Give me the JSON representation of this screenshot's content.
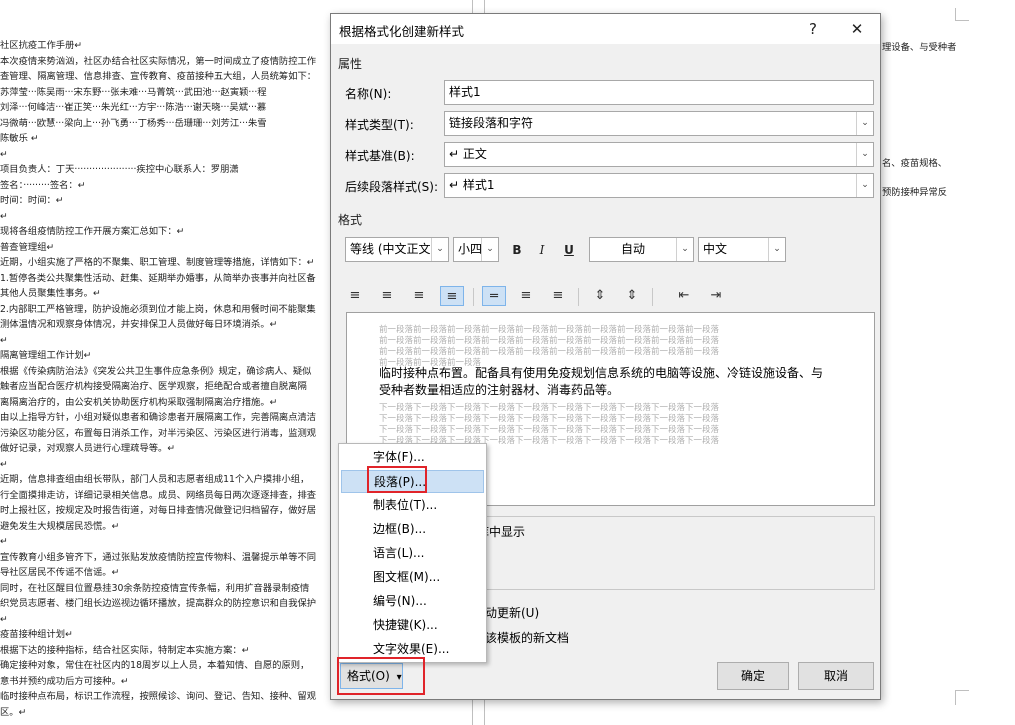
{
  "document": {
    "lines": [
      "社区抗疫工作手册↵",
      "本次疫情来势汹汹，社区办结合社区实际情况，第一时间成立了疫情防控工作",
      "查管理、隔离管理、信息排查、宣传教育、疫苗接种五大组，人员统筹如下：",
      "苏萍莹···陈吴雨···宋东野···张未难···马菁筑···武田池···赵寅颖···程",
      "刘泽···何峰洁···崔正笑···朱光红···方宇···陈浩···谢天晓···吴斌···慕",
      "冯微萌···欧慧···梁向上···孙飞勇···丁杨秀···岳珊珊···刘芳江···朱雪",
      "陈敏乐 ↵",
      "↵",
      "项目负责人：丁天·····················疾控中心联系人：罗朋潇",
      "签名：·········签名：↵",
      "时间：时间：↵",
      "↵",
      "现将各组疫情防控工作开展方案汇总如下：↵",
      "普查管理组↵",
      "近期，小组实施了严格的不聚集、职工管理、制度管理等措施，详情如下：↵",
      "1.暂停各类公共聚集性活动、赶集、延期举办婚事，从简举办丧事并向社区备",
      "其他人员聚集性事务。↵",
      "2.内部职工严格管理，防护设施必须到位才能上岗，休息和用餐时间不能聚集",
      "测体温情况和观察身体情况，并安排保卫人员做好每日环境消杀。↵",
      "↵",
      "隔离管理组工作计划↵",
      "根据《传染病防治法》《突发公共卫生事件应急条例》规定，确诊病人、疑似",
      "触者应当配合医疗机构接受隔离治疗、医学观察，拒绝配合或者擅自脱离隔",
      "离隔离治疗的，由公安机关协助医疗机构采取强制隔离治疗措施。↵",
      "由以上指导方针，小组对疑似患者和确诊患者开展隔离工作，完善隔离点清洁",
      "污染区功能分区，布置每日消杀工作，对半污染区、污染区进行消毒，监测观",
      "做好记录，对观察人员进行心理疏导等。↵",
      "↵",
      "近期，信息排查组由组长带队，部门人员和志愿者组成11个入户摸排小组，",
      "行全面摸排走访，详细记录相关信息。成员、网络员每日两次逐逐排查，排查",
      "时上报社区，按规定及时报告街道，对每日排查情况做登记归档留存，做好居",
      "避免发生大规模居民恐慌。↵",
      "↵",
      "宣传教育小组多管齐下，通过张贴发放疫情防控宣传物料、温馨提示单等不同",
      "导社区居民不传谣不信谣。↵",
      "同时，在社区醒目位置悬挂30余条防控疫情宣传条幅，利用扩音器录制疫情",
      "织党员志愿者、楼门组长边巡视边循环播放，提高群众的防控意识和自我保护",
      "↵",
      "疫苗接种组计划↵",
      "根据下达的接种指标，结合社区实际，特制定本实施方案：↵",
      "确定接种对象，常住在社区内的18周岁以上人员，本着知情、自愿的原则，",
      "意书并预约成功后方可接种。↵",
      "临时接种点布局，标识工作流程，按照候诊、询问、登记、告知、接种、留观",
      "区。↵"
    ],
    "right_lines": [
      "理设备、与受种者",
      "名、疫苗规格、",
      "预防接种异常反"
    ]
  },
  "dialog": {
    "title": "根据格式化创建新样式",
    "help": "?",
    "close": "✕",
    "section_properties": "属性",
    "name_label": "名称(N):",
    "name_value": "样式1",
    "type_label": "样式类型(T):",
    "type_value": "链接段落和字符",
    "base_label": "样式基准(B):",
    "base_value": "↵ 正文",
    "next_label": "后续段落样式(S):",
    "next_value": "↵ 样式1",
    "section_format": "格式",
    "font_value": "等线 (中文正文)",
    "size_value": "小四",
    "bold": "B",
    "italic": "I",
    "underline": "U",
    "color_value": "自动",
    "lang_value": "中文",
    "preview": {
      "prev_lines": [
        "前一段落前一段落前一段落前一段落前一段落前一段落前一段落前一段落前一段落前一段落",
        "前一段落前一段落前一段落前一段落前一段落前一段落前一段落前一段落前一段落前一段落",
        "前一段落前一段落前一段落前一段落前一段落前一段落前一段落前一段落前一段落前一段落",
        "前一段落前一段落前一段落"
      ],
      "main_lines": [
        "临时接种点布置。配备具有使用免疫规划信息系统的电脑等设施、冷链设施设备、与",
        "受种者数量相适应的注射器材、消毒药品等。"
      ],
      "next_lines": [
        "下一段落下一段落下一段落下一段落下一段落下一段落下一段落下一段落下一段落下一段落",
        "下一段落下一段落下一段落下一段落下一段落下一段落下一段落下一段落下一段落下一段落",
        "下一段落下一段落下一段落下一段落下一段落下一段落下一段落下一段落下一段落下一段落",
        "下一段落下一段落下一段落下一段落下一段落下一段落下一段落下一段落下一段落下一段落"
      ]
    },
    "desc_text": "库中显示",
    "auto_update": "动更新(U)",
    "new_docs": "该模板的新文档",
    "ok": "确定",
    "cancel": "取消",
    "format_button": "格式(O)",
    "format_arrow": "▾"
  },
  "menu": {
    "items": [
      "字体(F)...",
      "段落(P)...",
      "制表位(T)...",
      "边框(B)...",
      "语言(L)...",
      "图文框(M)...",
      "编号(N)...",
      "快捷键(K)...",
      "文字效果(E)..."
    ],
    "selected_index": 1
  },
  "accent": "#e0242a"
}
